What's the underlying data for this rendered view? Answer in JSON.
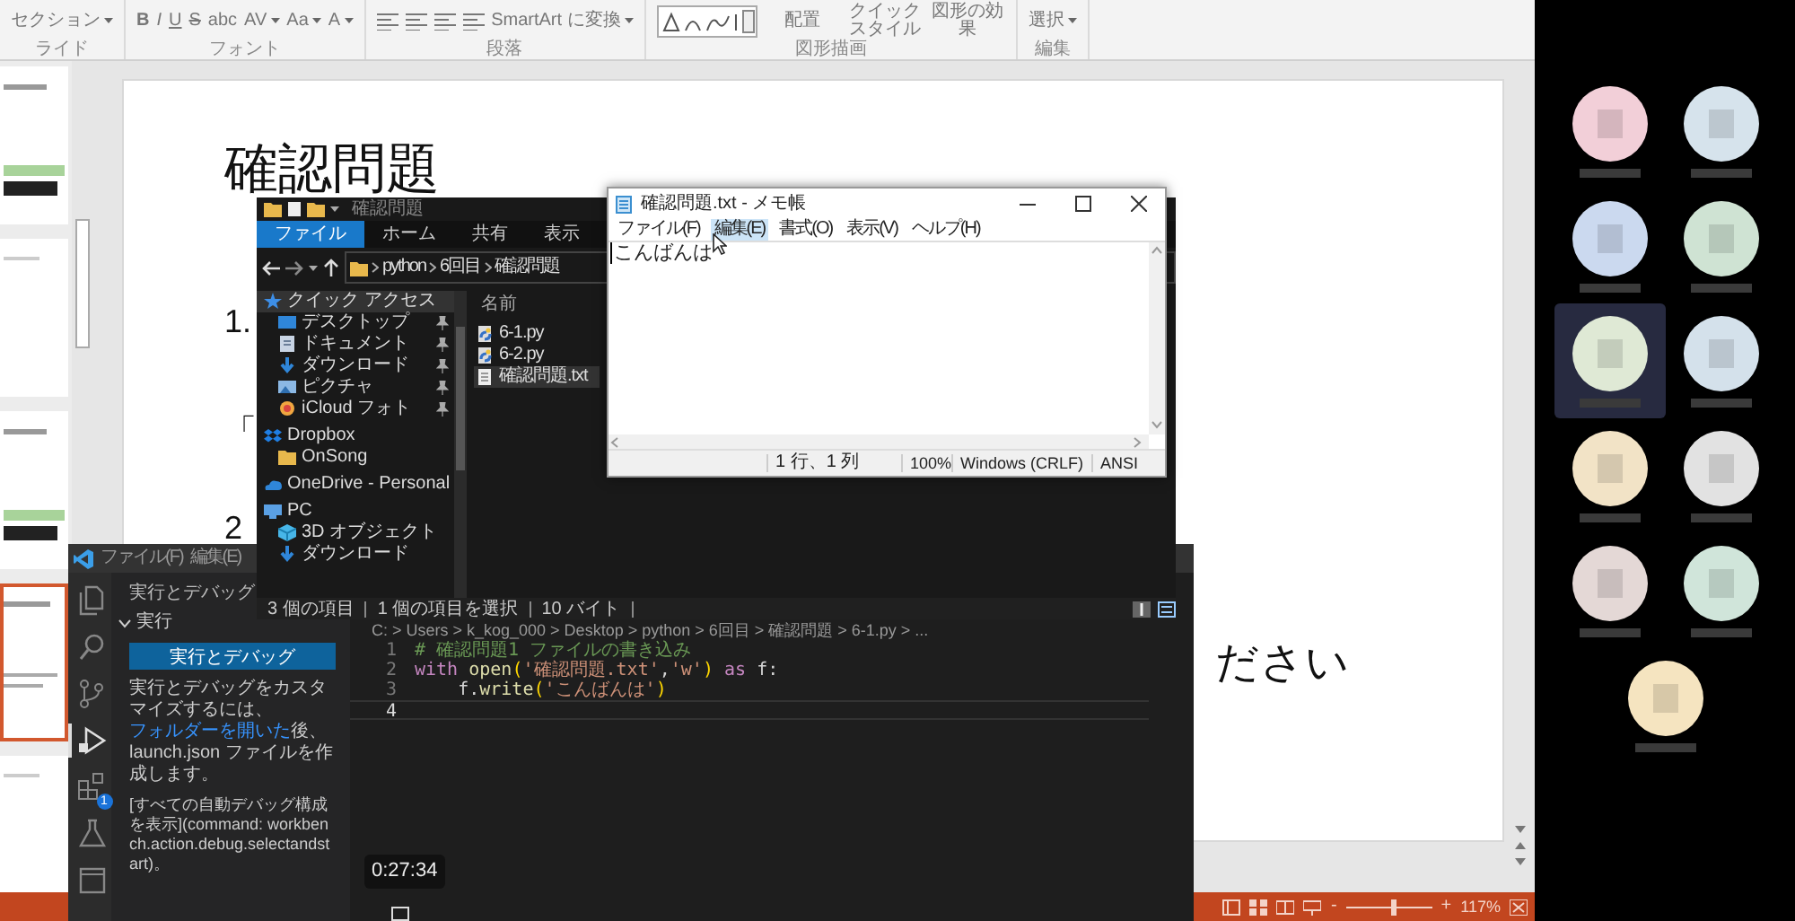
{
  "powerpoint": {
    "ribbon": [
      {
        "label": "ライド",
        "items": [
          {
            "kind": "dropdown",
            "text": "セクション"
          }
        ]
      },
      {
        "label": "フォント",
        "items": [
          {
            "kind": "bold",
            "text": "B"
          },
          {
            "kind": "italic",
            "text": "I"
          },
          {
            "kind": "underline",
            "text": "U"
          },
          {
            "kind": "strike",
            "text": "S"
          },
          {
            "kind": "text",
            "text": "abc"
          },
          {
            "kind": "dropdown",
            "text": "AV"
          },
          {
            "kind": "dropdown",
            "text": "Aa"
          },
          {
            "kind": "dropdown",
            "text": "A"
          }
        ]
      },
      {
        "label": "段落",
        "items": [
          {
            "kind": "align"
          },
          {
            "kind": "align"
          },
          {
            "kind": "align"
          },
          {
            "kind": "align"
          },
          {
            "kind": "dropdown",
            "text": "SmartArt に変換"
          }
        ]
      },
      {
        "label": "図形描画",
        "items": [
          {
            "kind": "gallery"
          },
          {
            "kind": "button",
            "text": "配置"
          },
          {
            "kind": "button",
            "text": "クイックスタイル"
          },
          {
            "kind": "button",
            "text": "図形の効果"
          }
        ]
      },
      {
        "label": "編集",
        "items": [
          {
            "kind": "dropdown",
            "text": "選択"
          }
        ]
      }
    ],
    "thumbnails": [
      {
        "kind": "code",
        "selected": false
      },
      {
        "kind": "blank",
        "selected": false
      },
      {
        "kind": "code",
        "selected": false
      },
      {
        "kind": "text",
        "selected": true
      },
      {
        "kind": "blank",
        "selected": false
      }
    ],
    "slide": {
      "title": "確認問題",
      "lines": [
        "1.",
        "「",
        "2"
      ],
      "tail": "ださい"
    },
    "status_bar": {
      "zoom": {
        "minus": "-",
        "level": 0.55,
        "plus": "+",
        "reading": "117%"
      }
    }
  },
  "explorer": {
    "title": "確認問題",
    "tabs": [
      {
        "label": "ファイル",
        "selected": true
      },
      {
        "label": "ホーム",
        "selected": false
      },
      {
        "label": "共有",
        "selected": false
      },
      {
        "label": "表示",
        "selected": false
      }
    ],
    "path": [
      "python",
      "6回目",
      "確認問題"
    ],
    "nav": [
      {
        "label": "クイック アクセス",
        "kind": "star",
        "selected": true,
        "children": [
          {
            "label": "デスクトップ",
            "kind": "desktop",
            "pinned": true,
            "selected": false
          },
          {
            "label": "ドキュメント",
            "kind": "document",
            "pinned": true,
            "selected": false
          },
          {
            "label": "ダウンロード",
            "kind": "download",
            "pinned": true,
            "selected": false
          },
          {
            "label": "ピクチャ",
            "kind": "picture",
            "pinned": true,
            "selected": false
          },
          {
            "label": "iCloud フォト",
            "kind": "cloud",
            "pinned": true,
            "selected": false
          }
        ]
      },
      {
        "label": "Dropbox",
        "kind": "dropbox",
        "selected": false,
        "children": [
          {
            "label": "OnSong",
            "kind": "folder",
            "selected": false
          }
        ]
      },
      {
        "label": "OneDrive - Personal",
        "kind": "onedrive",
        "selected": false
      },
      {
        "label": "PC",
        "kind": "pc",
        "selected": false,
        "children": [
          {
            "label": "3D オブジェクト",
            "kind": "cube",
            "selected": false
          },
          {
            "label": "ダウンロード",
            "kind": "download",
            "selected": false
          }
        ]
      }
    ],
    "column": "名前",
    "files": [
      {
        "name": "6-1.py",
        "kind": "python",
        "selected": false
      },
      {
        "name": "6-2.py",
        "kind": "python",
        "selected": false
      },
      {
        "name": "確認問題.txt",
        "kind": "text",
        "selected": true
      }
    ],
    "status": [
      "3 個の項目",
      "1 個の項目を選択",
      "10 バイト"
    ]
  },
  "notepad": {
    "title": "確認問題.txt - メモ帳",
    "menu": [
      {
        "label": "ファイル(F)",
        "selected": false
      },
      {
        "label": "編集(E)",
        "selected": true
      },
      {
        "label": "書式(O)",
        "selected": false
      },
      {
        "label": "表示(V)",
        "selected": false
      },
      {
        "label": "ヘルプ(H)",
        "selected": false
      }
    ],
    "text": "こんばんは",
    "status": [
      "1 行、1 列",
      "100%",
      "Windows (CRLF)",
      "ANSI"
    ]
  },
  "vscode": {
    "menu": [
      "ファイル(F)",
      "編集(E)"
    ],
    "activity": [
      {
        "kind": "files",
        "selected": false
      },
      {
        "kind": "search",
        "selected": false
      },
      {
        "kind": "branch",
        "selected": false
      },
      {
        "kind": "debug",
        "selected": true
      },
      {
        "kind": "extensions",
        "selected": false,
        "badge": "1"
      },
      {
        "kind": "flask",
        "selected": false
      },
      {
        "kind": "panel",
        "selected": false
      }
    ],
    "panel": {
      "title": "実行とデバッグ",
      "section": "実行",
      "button": "実行とデバッグ",
      "text_before": "実行とデバッグをカスタマイズするには、",
      "link": "フォルダーを開いた",
      "text_after": "後、launch.json ファイルを作成します。",
      "command": "[すべての自動デバッグ構成を表示](command: workbench.action.debug.selectandstart)。"
    },
    "breadcrumb": "C: > Users > k_kog_000 > Desktop > python > 6回目 > 確認問題 > 6-1.py > ...",
    "lines": [
      {
        "number": "1",
        "current": false,
        "tokens": [
          {
            "kind": "comment",
            "text": "# 確認問題1 ファイルの書き込み"
          }
        ]
      },
      {
        "number": "2",
        "current": false,
        "tokens": [
          {
            "kind": "keyword",
            "text": "with"
          },
          {
            "kind": "function",
            "text": " open"
          },
          {
            "kind": "paren",
            "text": "("
          },
          {
            "kind": "string",
            "text": "'確認問題.txt'"
          },
          {
            "kind": "plain",
            "text": ","
          },
          {
            "kind": "string",
            "text": "'w'"
          },
          {
            "kind": "paren",
            "text": ")"
          },
          {
            "kind": "keyword",
            "text": " as"
          },
          {
            "kind": "plain",
            "text": " f:"
          }
        ]
      },
      {
        "number": "3",
        "current": false,
        "tokens": [
          {
            "kind": "plain",
            "text": "    f."
          },
          {
            "kind": "function",
            "text": "write"
          },
          {
            "kind": "paren",
            "text": "("
          },
          {
            "kind": "string",
            "text": "'こんばんは'"
          },
          {
            "kind": "paren",
            "text": ")"
          }
        ]
      },
      {
        "number": "4",
        "current": true
      }
    ]
  },
  "video": {
    "timestamp": "0:27:34"
  },
  "participants": [
    {
      "color": "#f2cfd8",
      "selected": false
    },
    {
      "color": "#d6e3ec",
      "selected": false
    },
    {
      "color": "#cbd9ef",
      "selected": false
    },
    {
      "color": "#cfe3d3",
      "selected": false
    },
    {
      "color": "#dfe9d5",
      "selected": true
    },
    {
      "color": "#d4e1eb",
      "selected": false
    },
    {
      "color": "#f2e3c6",
      "selected": false
    },
    {
      "color": "#e2e2e2",
      "selected": false
    },
    {
      "color": "#e4d8d6",
      "selected": false
    },
    {
      "color": "#d0e5da",
      "selected": false
    },
    {
      "color": "#f5e4c0",
      "selected": false
    }
  ]
}
